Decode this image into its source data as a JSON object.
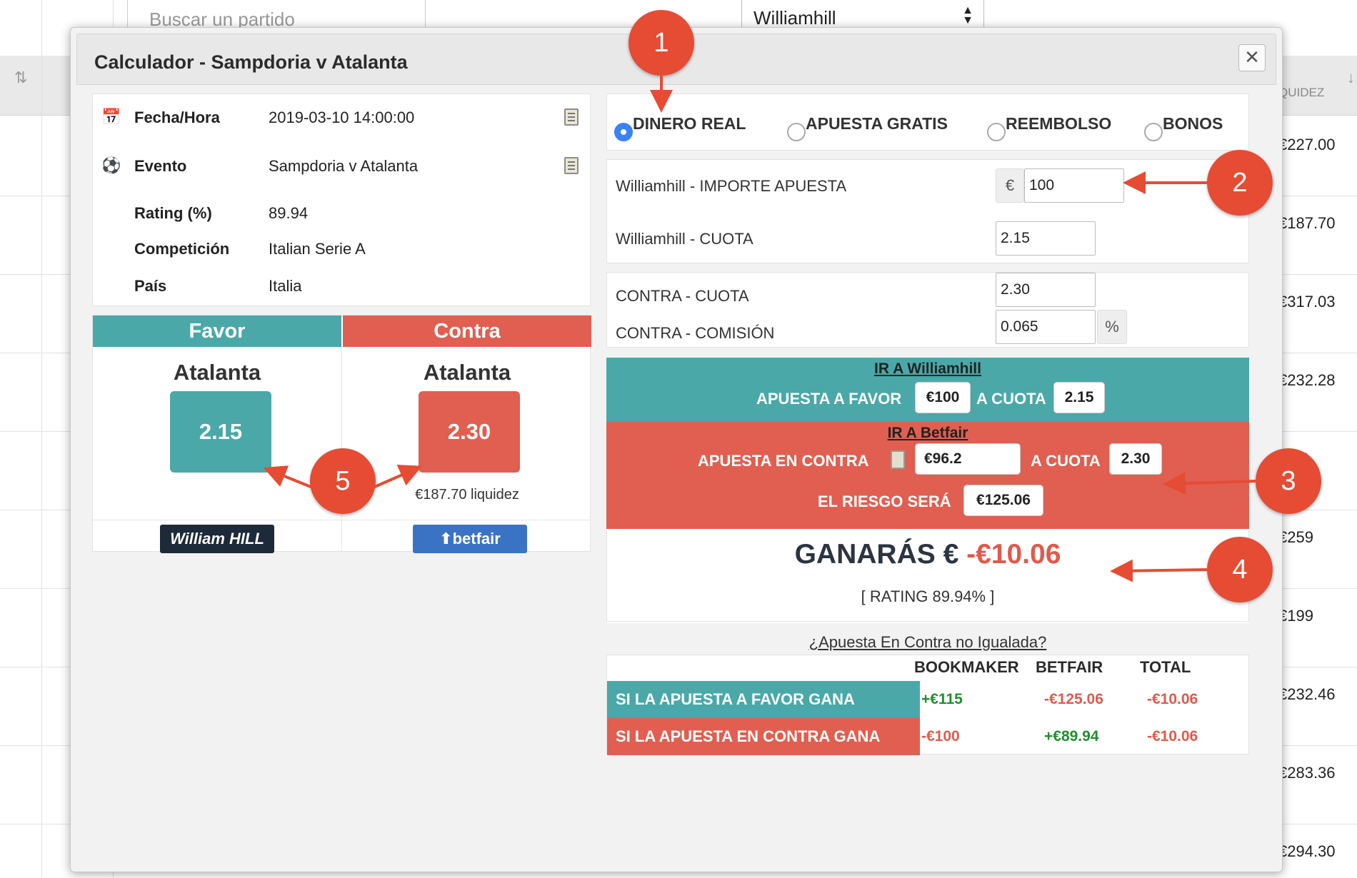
{
  "background": {
    "search_placeholder": "Buscar un partido",
    "bookmaker_select": "Williamhill",
    "column_label": "QUIDEZ",
    "liquidity_values": [
      "€227.00",
      "€187.70",
      "€317.03",
      "€232.28",
      "€...0",
      "€259",
      "€199",
      "€232.46",
      "€283.36",
      "€294.30"
    ]
  },
  "modal": {
    "title": "Calculador - Sampdoria v Atalanta",
    "close_label": "✕"
  },
  "event": {
    "rows": [
      {
        "icon": "calendar-icon",
        "label": "Fecha/Hora",
        "value": "2019-03-10 14:00:00",
        "copy": true
      },
      {
        "icon": "soccer-ball-icon",
        "label": "Evento",
        "value": "Sampdoria v Atalanta",
        "copy": true
      },
      {
        "icon": "",
        "label": "Rating (%)",
        "value": "89.94",
        "copy": false
      },
      {
        "icon": "",
        "label": "Competición",
        "value": "Italian Serie A",
        "copy": false
      },
      {
        "icon": "",
        "label": "País",
        "value": "Italia",
        "copy": false
      }
    ]
  },
  "favor": {
    "header": "Favor",
    "team": "Atalanta",
    "odds": "2.15",
    "bookmaker_logo": "William HILL",
    "color": "#4aa8a8"
  },
  "contra": {
    "header": "Contra",
    "team": "Atalanta",
    "odds": "2.30",
    "liquidity": "€187.70 liquidez",
    "exchange_logo": "betfair",
    "color": "#e05f50"
  },
  "bet_type": {
    "options": [
      "DINERO REAL",
      "APUESTA GRATIS",
      "REEMBOLSO",
      "BONOS"
    ],
    "selected": "DINERO REAL"
  },
  "back_inputs": {
    "stake_label": "Williamhill - IMPORTE APUESTA",
    "currency": "€",
    "stake_value": "100",
    "odds_label": "Williamhill - CUOTA",
    "odds_value": "2.15"
  },
  "lay_inputs": {
    "odds_label": "CONTRA - CUOTA",
    "odds_value": "2.30",
    "commission_label": "CONTRA - COMISIÓN",
    "commission_value": "0.065",
    "percent": "%"
  },
  "summary": {
    "go_bookmaker": "IR A Williamhill",
    "back_text": "APUESTA A FAVOR",
    "back_stake": "€100",
    "at_odds": "A CUOTA",
    "back_odds": "2.15",
    "go_exchange": "IR A Betfair",
    "lay_text": "APUESTA EN CONTRA",
    "lay_stake": "€96.2",
    "lay_odds": "2.30",
    "risk_text": "EL RIESGO SERÁ",
    "risk_value": "€125.06",
    "win_label": "GANARÁS €",
    "win_value": "-€10.06",
    "rating": "[ RATING 89.94% ]"
  },
  "unmatched_link": "¿Apuesta En Contra no Igualada?",
  "outcomes": {
    "columns": [
      "BOOKMAKER",
      "BETFAIR",
      "TOTAL"
    ],
    "rows": [
      {
        "label": "SI LA APUESTA A FAVOR GANA",
        "bookmaker": "+€115",
        "betfair": "-€125.06",
        "total": "-€10.06"
      },
      {
        "label": "SI LA APUESTA EN CONTRA GANA",
        "bookmaker": "-€100",
        "betfair": "+€89.94",
        "total": "-€10.06"
      }
    ]
  },
  "annotations": [
    "1",
    "2",
    "3",
    "4",
    "5"
  ],
  "colors": {
    "teal": "#4aa8a8",
    "red": "#e05f50",
    "badge": "#e54c33",
    "positive": "#1f8f2e",
    "negative": "#e05a4b"
  }
}
